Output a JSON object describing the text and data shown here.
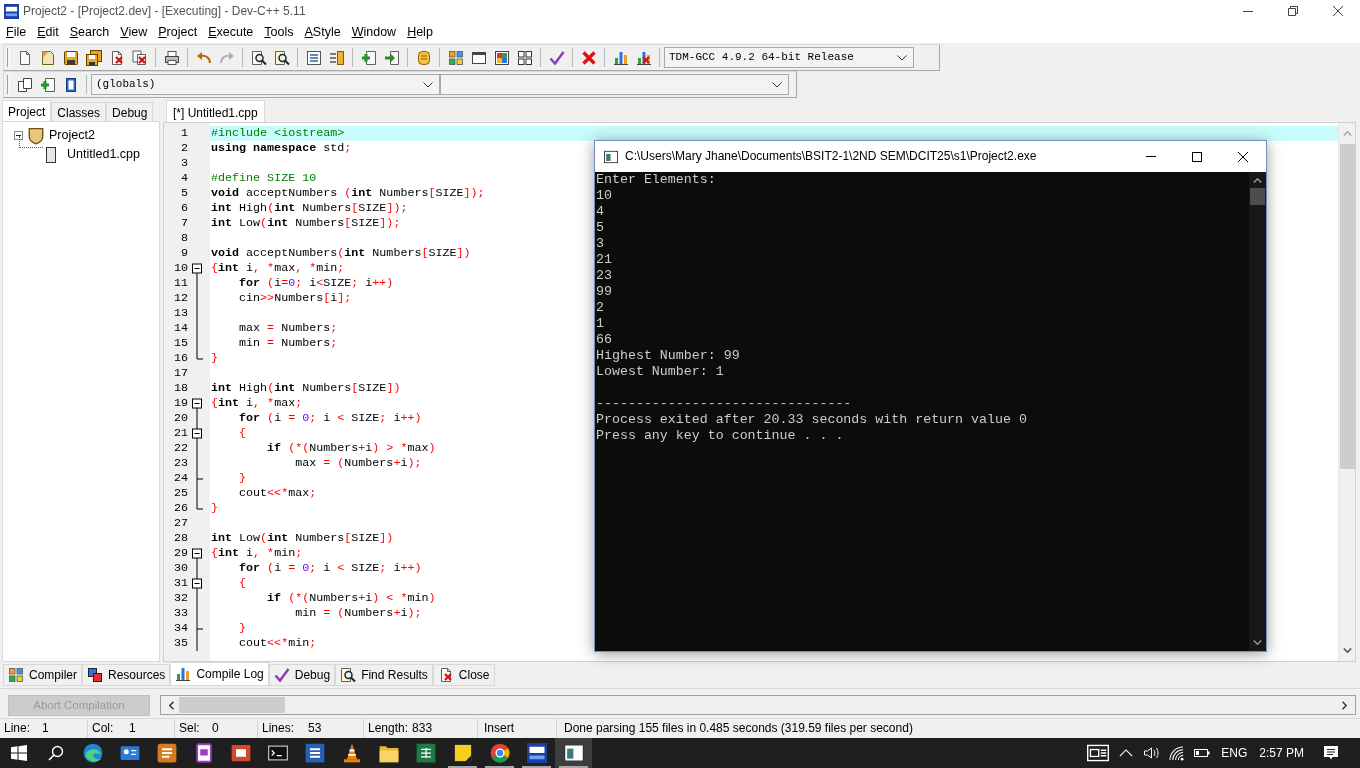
{
  "window": {
    "title": "Project2 - [Project2.dev] - [Executing] - Dev-C++ 5.11"
  },
  "menu": [
    "File",
    "Edit",
    "Search",
    "View",
    "Project",
    "Execute",
    "Tools",
    "AStyle",
    "Window",
    "Help"
  ],
  "toolbar": {
    "groups": [
      [
        {
          "disabled": false
        },
        {
          "disabled": false
        },
        {
          "disabled": false
        },
        {
          "disabled": false
        },
        {
          "disabled": false
        },
        {
          "disabled": false
        }
      ],
      [
        {
          "disabled": false
        }
      ],
      [
        {
          "disabled": false
        },
        {
          "disabled": true
        }
      ],
      [
        {
          "disabled": false
        },
        {
          "disabled": false
        }
      ],
      [
        {
          "disabled": false
        },
        {
          "disabled": false
        }
      ],
      [
        {
          "disabled": false
        },
        {
          "disabled": false
        }
      ],
      [
        {
          "disabled": false
        }
      ],
      [
        {
          "disabled": false
        },
        {
          "disabled": false
        },
        {
          "disabled": false
        },
        {
          "disabled": false
        }
      ],
      [
        {
          "disabled": false
        }
      ],
      [
        {
          "disabled": false
        }
      ],
      [
        {
          "disabled": false
        },
        {
          "disabled": false
        }
      ]
    ],
    "compiler": "TDM-GCC 4.9.2 64-bit Release"
  },
  "toolbar_2": {
    "groups": [
      [
        {
          "disabled": false
        },
        {
          "disabled": false
        },
        {
          "disabled": false
        }
      ]
    ],
    "scope": "(globals)"
  },
  "left_panel": {
    "tabs": [
      {
        "label": "Project",
        "selected": true
      },
      {
        "label": "Classes",
        "selected": false
      },
      {
        "label": "Debug",
        "selected": false
      }
    ],
    "tree": [
      {
        "label": "Project2",
        "expanded": true,
        "children": [
          {
            "label": "Untitled1.cpp"
          }
        ]
      }
    ]
  },
  "editor": {
    "tabs": [
      {
        "label": "[*] Untitled1.cpp",
        "selected": true
      }
    ],
    "lines": [
      {
        "number": "1",
        "current": true,
        "kind": "plain",
        "tokens": [
          {
            "kind": "pre",
            "text": "#include <iostream>"
          }
        ]
      },
      {
        "number": "2",
        "current": false,
        "kind": "plain",
        "tokens": [
          {
            "kind": "kw",
            "text": "using namespace"
          },
          {
            "kind": "txt",
            "text": " std"
          },
          {
            "kind": "sym",
            "text": ";"
          }
        ]
      },
      {
        "number": "3",
        "current": false,
        "kind": "plain"
      },
      {
        "number": "4",
        "current": false,
        "kind": "plain",
        "tokens": [
          {
            "kind": "pre",
            "text": "#define SIZE 10"
          }
        ]
      },
      {
        "number": "5",
        "current": false,
        "kind": "plain",
        "tokens": [
          {
            "kind": "kw",
            "text": "void"
          },
          {
            "kind": "txt",
            "text": " acceptNumbers "
          },
          {
            "kind": "sym",
            "text": "("
          },
          {
            "kind": "kw",
            "text": "int"
          },
          {
            "kind": "txt",
            "text": " Numbers"
          },
          {
            "kind": "sym",
            "text": "["
          },
          {
            "kind": "txt",
            "text": "SIZE"
          },
          {
            "kind": "sym",
            "text": "]);"
          }
        ]
      },
      {
        "number": "6",
        "current": false,
        "kind": "plain",
        "tokens": [
          {
            "kind": "kw",
            "text": "int"
          },
          {
            "kind": "txt",
            "text": " High"
          },
          {
            "kind": "sym",
            "text": "("
          },
          {
            "kind": "kw",
            "text": "int"
          },
          {
            "kind": "txt",
            "text": " Numbers"
          },
          {
            "kind": "sym",
            "text": "["
          },
          {
            "kind": "txt",
            "text": "SIZE"
          },
          {
            "kind": "sym",
            "text": "]);"
          }
        ]
      },
      {
        "number": "7",
        "current": false,
        "kind": "plain",
        "tokens": [
          {
            "kind": "kw",
            "text": "int"
          },
          {
            "kind": "txt",
            "text": " Low"
          },
          {
            "kind": "sym",
            "text": "("
          },
          {
            "kind": "kw",
            "text": "int"
          },
          {
            "kind": "txt",
            "text": " Numbers"
          },
          {
            "kind": "sym",
            "text": "["
          },
          {
            "kind": "txt",
            "text": "SIZE"
          },
          {
            "kind": "sym",
            "text": "]);"
          }
        ]
      },
      {
        "number": "8",
        "current": false,
        "kind": "plain"
      },
      {
        "number": "9",
        "current": false,
        "kind": "plain",
        "tokens": [
          {
            "kind": "kw",
            "text": "void"
          },
          {
            "kind": "txt",
            "text": " acceptNumbers"
          },
          {
            "kind": "sym",
            "text": "("
          },
          {
            "kind": "kw",
            "text": "int"
          },
          {
            "kind": "txt",
            "text": " Numbers"
          },
          {
            "kind": "sym",
            "text": "["
          },
          {
            "kind": "txt",
            "text": "SIZE"
          },
          {
            "kind": "sym",
            "text": "])"
          }
        ]
      },
      {
        "number": "10",
        "current": false,
        "kind": "fold_start",
        "tokens": [
          {
            "kind": "sym",
            "text": "{"
          },
          {
            "kind": "kw",
            "text": "int"
          },
          {
            "kind": "txt",
            "text": " i"
          },
          {
            "kind": "sym",
            "text": ", *"
          },
          {
            "kind": "txt",
            "text": "max"
          },
          {
            "kind": "sym",
            "text": ", *"
          },
          {
            "kind": "txt",
            "text": "min"
          },
          {
            "kind": "sym",
            "text": ";"
          }
        ]
      },
      {
        "number": "11",
        "current": false,
        "kind": "fold_body",
        "tokens": [
          {
            "kind": "kw",
            "text": "    for "
          },
          {
            "kind": "sym",
            "text": "("
          },
          {
            "kind": "txt",
            "text": "i"
          },
          {
            "kind": "sym",
            "text": "="
          },
          {
            "kind": "num",
            "text": "0"
          },
          {
            "kind": "sym",
            "text": ";"
          },
          {
            "kind": "txt",
            "text": " i"
          },
          {
            "kind": "sym",
            "text": "<"
          },
          {
            "kind": "txt",
            "text": "SIZE"
          },
          {
            "kind": "sym",
            "text": ";"
          },
          {
            "kind": "txt",
            "text": " i"
          },
          {
            "kind": "sym",
            "text": "++)"
          }
        ]
      },
      {
        "number": "12",
        "current": false,
        "kind": "fold_body",
        "tokens": [
          {
            "kind": "txt",
            "text": "    cin"
          },
          {
            "kind": "sym",
            "text": ">>"
          },
          {
            "kind": "txt",
            "text": "Numbers"
          },
          {
            "kind": "sym",
            "text": "["
          },
          {
            "kind": "txt",
            "text": "i"
          },
          {
            "kind": "sym",
            "text": "];"
          }
        ]
      },
      {
        "number": "13",
        "current": false,
        "kind": "fold_body"
      },
      {
        "number": "14",
        "current": false,
        "kind": "fold_body",
        "tokens": [
          {
            "kind": "txt",
            "text": "    max "
          },
          {
            "kind": "sym",
            "text": "="
          },
          {
            "kind": "txt",
            "text": " Numbers"
          },
          {
            "kind": "sym",
            "text": ";"
          }
        ]
      },
      {
        "number": "15",
        "current": false,
        "kind": "fold_body",
        "tokens": [
          {
            "kind": "txt",
            "text": "    min "
          },
          {
            "kind": "sym",
            "text": "="
          },
          {
            "kind": "txt",
            "text": " Numbers"
          },
          {
            "kind": "sym",
            "text": ";"
          }
        ]
      },
      {
        "number": "16",
        "current": false,
        "kind": "fold_end",
        "tokens": [
          {
            "kind": "sym",
            "text": "}"
          }
        ]
      },
      {
        "number": "17",
        "current": false,
        "kind": "plain"
      },
      {
        "number": "18",
        "current": false,
        "kind": "plain",
        "tokens": [
          {
            "kind": "kw",
            "text": "int"
          },
          {
            "kind": "txt",
            "text": " High"
          },
          {
            "kind": "sym",
            "text": "("
          },
          {
            "kind": "kw",
            "text": "int"
          },
          {
            "kind": "txt",
            "text": " Numbers"
          },
          {
            "kind": "sym",
            "text": "["
          },
          {
            "kind": "txt",
            "text": "SIZE"
          },
          {
            "kind": "sym",
            "text": "])"
          }
        ]
      },
      {
        "number": "19",
        "current": false,
        "kind": "fold_start",
        "tokens": [
          {
            "kind": "sym",
            "text": "{"
          },
          {
            "kind": "kw",
            "text": "int"
          },
          {
            "kind": "txt",
            "text": " i"
          },
          {
            "kind": "sym",
            "text": ", *"
          },
          {
            "kind": "txt",
            "text": "max"
          },
          {
            "kind": "sym",
            "text": ";"
          }
        ]
      },
      {
        "number": "20",
        "current": false,
        "kind": "fold_body",
        "tokens": [
          {
            "kind": "kw",
            "text": "    for "
          },
          {
            "kind": "sym",
            "text": "("
          },
          {
            "kind": "txt",
            "text": "i "
          },
          {
            "kind": "sym",
            "text": "= "
          },
          {
            "kind": "num",
            "text": "0"
          },
          {
            "kind": "sym",
            "text": ";"
          },
          {
            "kind": "txt",
            "text": " i "
          },
          {
            "kind": "sym",
            "text": "< "
          },
          {
            "kind": "txt",
            "text": "SIZE"
          },
          {
            "kind": "sym",
            "text": ";"
          },
          {
            "kind": "txt",
            "text": " i"
          },
          {
            "kind": "sym",
            "text": "++)"
          }
        ]
      },
      {
        "number": "21",
        "current": false,
        "kind": "fold_nested_start",
        "tokens": [
          {
            "kind": "sym",
            "text": "    {"
          }
        ]
      },
      {
        "number": "22",
        "current": false,
        "kind": "fold_body",
        "tokens": [
          {
            "kind": "kw",
            "text": "        if "
          },
          {
            "kind": "sym",
            "text": "(*("
          },
          {
            "kind": "txt",
            "text": "Numbers"
          },
          {
            "kind": "sym",
            "text": "+"
          },
          {
            "kind": "txt",
            "text": "i"
          },
          {
            "kind": "sym",
            "text": ") > *"
          },
          {
            "kind": "txt",
            "text": "max"
          },
          {
            "kind": "sym",
            "text": ")"
          }
        ]
      },
      {
        "number": "23",
        "current": false,
        "kind": "fold_body",
        "tokens": [
          {
            "kind": "txt",
            "text": "            max "
          },
          {
            "kind": "sym",
            "text": "= ("
          },
          {
            "kind": "txt",
            "text": "Numbers"
          },
          {
            "kind": "sym",
            "text": "+"
          },
          {
            "kind": "txt",
            "text": "i"
          },
          {
            "kind": "sym",
            "text": ");"
          }
        ]
      },
      {
        "number": "24",
        "current": false,
        "kind": "fold_nested_end",
        "tokens": [
          {
            "kind": "sym",
            "text": "    }"
          }
        ]
      },
      {
        "number": "25",
        "current": false,
        "kind": "fold_body",
        "tokens": [
          {
            "kind": "txt",
            "text": "    cout"
          },
          {
            "kind": "sym",
            "text": "<<*"
          },
          {
            "kind": "txt",
            "text": "max"
          },
          {
            "kind": "sym",
            "text": ";"
          }
        ]
      },
      {
        "number": "26",
        "current": false,
        "kind": "fold_end",
        "tokens": [
          {
            "kind": "sym",
            "text": "}"
          }
        ]
      },
      {
        "number": "27",
        "current": false,
        "kind": "plain"
      },
      {
        "number": "28",
        "current": false,
        "kind": "plain",
        "tokens": [
          {
            "kind": "kw",
            "text": "int"
          },
          {
            "kind": "txt",
            "text": " Low"
          },
          {
            "kind": "sym",
            "text": "("
          },
          {
            "kind": "kw",
            "text": "int"
          },
          {
            "kind": "txt",
            "text": " Numbers"
          },
          {
            "kind": "sym",
            "text": "["
          },
          {
            "kind": "txt",
            "text": "SIZE"
          },
          {
            "kind": "sym",
            "text": "])"
          }
        ]
      },
      {
        "number": "29",
        "current": false,
        "kind": "fold_start",
        "tokens": [
          {
            "kind": "sym",
            "text": "{"
          },
          {
            "kind": "kw",
            "text": "int"
          },
          {
            "kind": "txt",
            "text": " i"
          },
          {
            "kind": "sym",
            "text": ", *"
          },
          {
            "kind": "txt",
            "text": "min"
          },
          {
            "kind": "sym",
            "text": ";"
          }
        ]
      },
      {
        "number": "30",
        "current": false,
        "kind": "fold_body",
        "tokens": [
          {
            "kind": "kw",
            "text": "    for "
          },
          {
            "kind": "sym",
            "text": "("
          },
          {
            "kind": "txt",
            "text": "i "
          },
          {
            "kind": "sym",
            "text": "= "
          },
          {
            "kind": "num",
            "text": "0"
          },
          {
            "kind": "sym",
            "text": ";"
          },
          {
            "kind": "txt",
            "text": " i "
          },
          {
            "kind": "sym",
            "text": "< "
          },
          {
            "kind": "txt",
            "text": "SIZE"
          },
          {
            "kind": "sym",
            "text": ";"
          },
          {
            "kind": "txt",
            "text": " i"
          },
          {
            "kind": "sym",
            "text": "++)"
          }
        ]
      },
      {
        "number": "31",
        "current": false,
        "kind": "fold_nested_start",
        "tokens": [
          {
            "kind": "sym",
            "text": "    {"
          }
        ]
      },
      {
        "number": "32",
        "current": false,
        "kind": "fold_body",
        "tokens": [
          {
            "kind": "kw",
            "text": "        if "
          },
          {
            "kind": "sym",
            "text": "(*("
          },
          {
            "kind": "txt",
            "text": "Numbers"
          },
          {
            "kind": "sym",
            "text": "+"
          },
          {
            "kind": "txt",
            "text": "i"
          },
          {
            "kind": "sym",
            "text": ") < *"
          },
          {
            "kind": "txt",
            "text": "min"
          },
          {
            "kind": "sym",
            "text": ")"
          }
        ]
      },
      {
        "number": "33",
        "current": false,
        "kind": "fold_body",
        "tokens": [
          {
            "kind": "txt",
            "text": "            min "
          },
          {
            "kind": "sym",
            "text": "= ("
          },
          {
            "kind": "txt",
            "text": "Numbers"
          },
          {
            "kind": "sym",
            "text": "+"
          },
          {
            "kind": "txt",
            "text": "i"
          },
          {
            "kind": "sym",
            "text": ");"
          }
        ]
      },
      {
        "number": "34",
        "current": false,
        "kind": "fold_nested_end",
        "tokens": [
          {
            "kind": "sym",
            "text": "    }"
          }
        ]
      },
      {
        "number": "35",
        "current": false,
        "kind": "fold_body",
        "tokens": [
          {
            "kind": "txt",
            "text": "    cout"
          },
          {
            "kind": "sym",
            "text": "<<*"
          },
          {
            "kind": "txt",
            "text": "min"
          },
          {
            "kind": "sym",
            "text": ";"
          }
        ]
      }
    ]
  },
  "console": {
    "title": "C:\\Users\\Mary Jhane\\Documents\\BSIT2-1\\2ND SEM\\DCIT25\\s1\\Project2.exe",
    "blocks": [
      [
        "Enter Elements:",
        "10",
        "4",
        "5",
        "3",
        "21",
        "23",
        "99",
        "2",
        "1",
        "66",
        "Highest Number: 99",
        "Lowest Number: 1"
      ],
      [
        "--------------------------------",
        "Process exited after 20.33 seconds with return value 0",
        "Press any key to continue . . ."
      ]
    ]
  },
  "bottom_tabs": [
    {
      "label": "Compiler",
      "selected": false
    },
    {
      "label": "Resources",
      "selected": false
    },
    {
      "label": "Compile Log",
      "selected": true
    },
    {
      "label": "Debug",
      "selected": false
    },
    {
      "label": "Find Results",
      "selected": false
    },
    {
      "label": "Close",
      "selected": false
    }
  ],
  "compile_log": {
    "abort_button": {
      "label": "Abort Compilation",
      "disabled": true
    }
  },
  "status_bar": {
    "fields": [
      {
        "label": "Line:",
        "value": "1"
      },
      {
        "label": "Col:",
        "value": "1"
      },
      {
        "label": "Sel:",
        "value": "0"
      },
      {
        "label": "Lines:",
        "value": "53"
      },
      {
        "label": "Length:",
        "value": "833"
      }
    ],
    "mode": "Insert",
    "message": "Done parsing 155 files in 0.485 seconds (319.59 files per second)"
  },
  "taskbar": {
    "apps": [
      {
        "selected": false,
        "running": false
      },
      {
        "selected": false,
        "running": false
      },
      {
        "selected": false,
        "running": false
      },
      {
        "selected": false,
        "running": false
      },
      {
        "selected": false,
        "running": false
      },
      {
        "selected": false,
        "running": false
      },
      {
        "selected": false,
        "running": false
      },
      {
        "selected": false,
        "running": false
      },
      {
        "selected": false,
        "running": false
      },
      {
        "selected": false,
        "running": false
      },
      {
        "selected": false,
        "running": true
      },
      {
        "selected": false,
        "running": true
      },
      {
        "selected": false,
        "running": true
      },
      {
        "selected": true,
        "running": true
      }
    ],
    "language": "ENG",
    "time": "2:57 PM"
  }
}
